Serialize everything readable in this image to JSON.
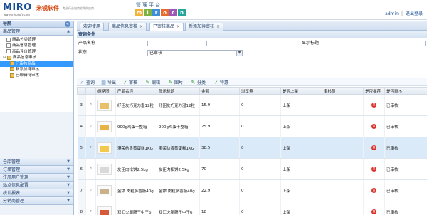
{
  "header": {
    "logo_text": "MIRO",
    "logo_site": "www.mirosoft.com",
    "logo_cn": "米锐软件",
    "slogan": "专业行业电商软件供应商",
    "mgmt_title": "管理平台",
    "mgmt_blocks": [
      "m",
      "i",
      "r",
      "o",
      "c",
      "n"
    ],
    "user": "admin",
    "logout": "退出登录"
  },
  "sidebar": {
    "title": "导航",
    "group_title": "商品管理",
    "tree": [
      {
        "label": "商品分类管理",
        "level": 1,
        "type": "file"
      },
      {
        "label": "商品信息管理",
        "level": 1,
        "type": "file"
      },
      {
        "label": "商品评价管理",
        "level": 1,
        "type": "file"
      },
      {
        "label": "商品信息审核",
        "level": 0,
        "type": "folder"
      },
      {
        "label": "已审核商品",
        "level": 2,
        "type": "folder",
        "selected": true
      },
      {
        "label": "新添加待审核",
        "level": 2,
        "type": "folder"
      },
      {
        "label": "已编辑待审核",
        "level": 2,
        "type": "folder"
      }
    ],
    "accordion": [
      "仓库管理",
      "订单管理",
      "注册用户管理",
      "站点信息配置",
      "统计报表",
      "分销商管理"
    ]
  },
  "tabs": [
    {
      "label": "欢迎使用",
      "closable": false,
      "active": false
    },
    {
      "label": "商品信息审核",
      "closable": true,
      "active": false
    },
    {
      "label": "已审核商品",
      "closable": true,
      "active": true
    },
    {
      "label": "新添加待审核",
      "closable": true,
      "active": false
    }
  ],
  "search": {
    "title": "查询条件",
    "product_name_label": "产品名称",
    "product_name_value": "",
    "display_title_label": "显示标题",
    "display_title_value": "",
    "status_label": "状态",
    "status_value": "已审核"
  },
  "toolbar": {
    "query": "查询",
    "export": "导出",
    "audit": "审核",
    "edit": "编辑",
    "image": "图片",
    "category": "分类",
    "specialprice": "特惠"
  },
  "grid": {
    "headers": [
      "",
      "",
      "缩略图",
      "产品名称",
      "显示标题",
      "金额",
      "浏览量",
      "是否上架",
      "审核员",
      "是否推荐",
      "是否审核"
    ],
    "rows": [
      {
        "num": "3",
        "name": "纾困友巧克力湿12粒",
        "title": "纾困友巧克力湿12粒",
        "price": "15.9",
        "views": "0",
        "shelf": "上架",
        "auditor": "",
        "recommend": "✕",
        "audit": "已审核",
        "highlight": false
      },
      {
        "num": "4",
        "name": "900g鸡蛋干整箱",
        "title": "900g鸡蛋干整箱",
        "price": "25.9",
        "views": "0",
        "shelf": "上架",
        "auditor": "",
        "recommend": "✕",
        "audit": "已审核",
        "highlight": false
      },
      {
        "num": "5",
        "name": "港荣纺香蒸蛋糕1KG",
        "title": "港荣纺香蒸蛋糕1KG",
        "price": "38.5",
        "views": "0",
        "shelf": "上架",
        "auditor": "",
        "recommend": "✕",
        "audit": "已审核",
        "highlight": true
      },
      {
        "num": "6",
        "name": "友臣肉松饼2.5kg",
        "title": "友臣肉松饼2.5kg",
        "price": "70",
        "views": "0",
        "shelf": "上架",
        "auditor": "",
        "recommend": "✕",
        "audit": "已审核",
        "highlight": false
      },
      {
        "num": "7",
        "name": "金锣 肉粒多香肠40g",
        "title": "金锣 肉粒多香肠40g",
        "price": "22.9",
        "views": "0",
        "shelf": "上架",
        "auditor": "",
        "recommend": "✕",
        "audit": "已审核",
        "highlight": false
      },
      {
        "num": "8",
        "name": "双汇火腿肠王中王6",
        "title": "双汇火腿肠王中王6",
        "price": "18",
        "views": "0",
        "shelf": "上架",
        "auditor": "",
        "recommend": "✕",
        "audit": "已审核",
        "highlight": false
      }
    ]
  },
  "colors": {
    "brand": "#1a4f96",
    "accent": "#d44b16",
    "selected": "#3399ff",
    "reject": "#d9312a"
  }
}
